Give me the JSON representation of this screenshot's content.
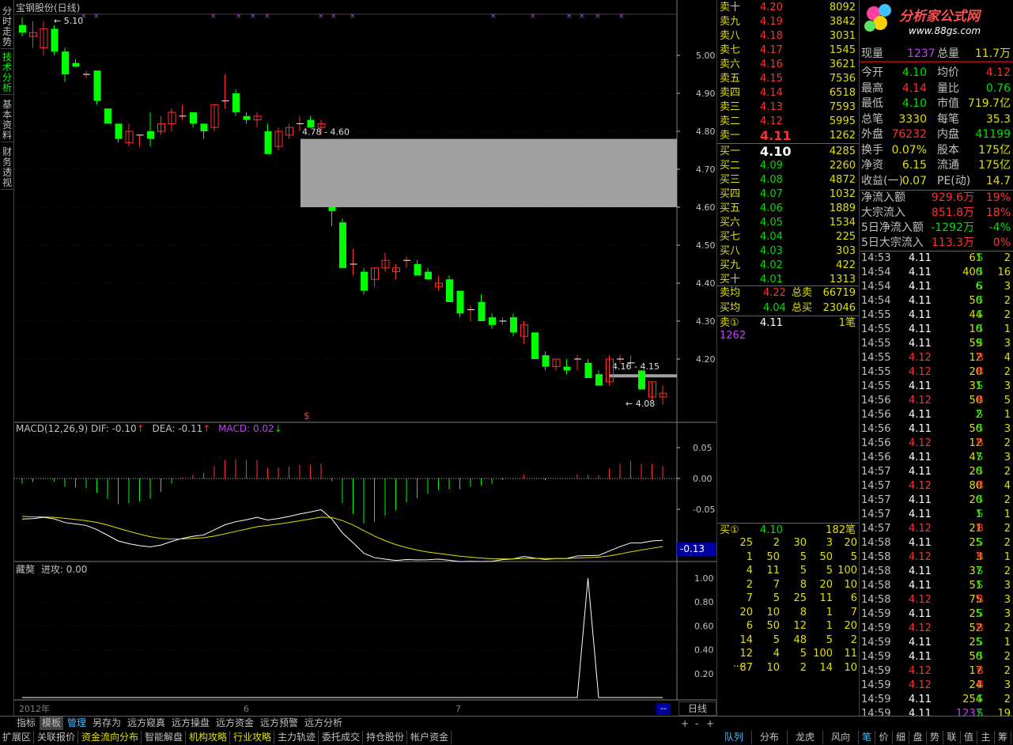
{
  "vertical_tabs": [
    {
      "label": "分时走势",
      "active": false
    },
    {
      "label": "技术分析",
      "active": true
    },
    {
      "label": "基本资料",
      "active": false
    },
    {
      "label": "财务透视",
      "active": false
    }
  ],
  "chart": {
    "title": "宝钢股份(日线)",
    "high_marker": "5.10",
    "low_marker": "4.08",
    "gap1_label": "4.78 - 4.60",
    "gap2_label": "4.16 - 4.15",
    "special_marker": "$",
    "price_axis": [
      "5.00",
      "4.90",
      "4.80",
      "4.70",
      "4.60",
      "4.50",
      "4.40",
      "4.30",
      "4.20"
    ],
    "candles": [
      [
        5.08,
        5.1,
        5.05,
        5.06
      ],
      [
        5.05,
        5.09,
        5.02,
        5.06
      ],
      [
        5.02,
        5.09,
        5.0,
        5.07
      ],
      [
        5.07,
        5.08,
        5.0,
        5.01
      ],
      [
        5.01,
        5.02,
        4.93,
        4.95
      ],
      [
        4.98,
        4.99,
        4.97,
        4.97
      ],
      [
        4.95,
        4.96,
        4.94,
        4.95
      ],
      [
        4.96,
        4.96,
        4.87,
        4.88
      ],
      [
        4.86,
        4.86,
        4.82,
        4.82
      ],
      [
        4.82,
        4.82,
        4.77,
        4.78
      ],
      [
        4.77,
        4.82,
        4.76,
        4.8
      ],
      [
        4.79,
        4.79,
        4.76,
        4.79
      ],
      [
        4.8,
        4.85,
        4.76,
        4.78
      ],
      [
        4.8,
        4.84,
        4.79,
        4.82
      ],
      [
        4.82,
        4.86,
        4.8,
        4.85
      ],
      [
        4.84,
        4.87,
        4.83,
        4.84
      ],
      [
        4.85,
        4.85,
        4.81,
        4.82
      ],
      [
        4.82,
        4.82,
        4.78,
        4.8
      ],
      [
        4.81,
        4.87,
        4.8,
        4.87
      ],
      [
        4.88,
        4.95,
        4.86,
        4.88
      ],
      [
        4.9,
        4.91,
        4.84,
        4.85
      ],
      [
        4.84,
        4.85,
        4.82,
        4.83
      ],
      [
        4.83,
        4.85,
        4.81,
        4.84
      ],
      [
        4.8,
        4.82,
        4.74,
        4.74
      ],
      [
        4.76,
        4.81,
        4.75,
        4.8
      ],
      [
        4.79,
        4.82,
        4.78,
        4.81
      ],
      [
        4.82,
        4.84,
        4.8,
        4.82
      ],
      [
        4.83,
        4.84,
        4.81,
        4.81
      ],
      [
        4.81,
        4.83,
        4.79,
        4.82
      ],
      [
        4.6,
        4.6,
        4.55,
        4.59
      ],
      [
        4.56,
        4.57,
        4.44,
        4.44
      ],
      [
        4.45,
        4.49,
        4.42,
        4.45
      ],
      [
        4.43,
        4.44,
        4.37,
        4.38
      ],
      [
        4.41,
        4.44,
        4.39,
        4.44
      ],
      [
        4.44,
        4.48,
        4.43,
        4.46
      ],
      [
        4.43,
        4.45,
        4.41,
        4.44
      ],
      [
        4.46,
        4.47,
        4.44,
        4.46
      ],
      [
        4.45,
        4.46,
        4.42,
        4.42
      ],
      [
        4.43,
        4.44,
        4.41,
        4.41
      ],
      [
        4.39,
        4.42,
        4.38,
        4.4
      ],
      [
        4.41,
        4.42,
        4.35,
        4.35
      ],
      [
        4.38,
        4.38,
        4.31,
        4.32
      ],
      [
        4.33,
        4.34,
        4.3,
        4.33
      ],
      [
        4.35,
        4.37,
        4.3,
        4.3
      ],
      [
        4.31,
        4.32,
        4.28,
        4.29
      ],
      [
        4.3,
        4.31,
        4.29,
        4.3
      ],
      [
        4.31,
        4.32,
        4.26,
        4.27
      ],
      [
        4.26,
        4.3,
        4.24,
        4.29
      ],
      [
        4.27,
        4.27,
        4.2,
        4.2
      ],
      [
        4.21,
        4.22,
        4.17,
        4.18
      ],
      [
        4.18,
        4.2,
        4.17,
        4.2
      ],
      [
        4.18,
        4.2,
        4.16,
        4.17
      ],
      [
        4.2,
        4.21,
        4.17,
        4.2
      ],
      [
        4.19,
        4.2,
        4.15,
        4.15
      ],
      [
        4.16,
        4.17,
        4.13,
        4.13
      ],
      [
        4.14,
        4.21,
        4.13,
        4.2
      ],
      [
        4.2,
        4.21,
        4.19,
        4.2
      ],
      [
        4.19,
        4.21,
        4.18,
        4.19
      ],
      [
        4.17,
        4.17,
        4.12,
        4.12
      ],
      [
        4.1,
        4.14,
        4.09,
        4.14
      ],
      [
        4.1,
        4.13,
        4.08,
        4.11
      ]
    ]
  },
  "macd": {
    "title": "MACD(12,26,9)",
    "dif_label": "DIF: -0.10",
    "dea_label": "DEA: -0.11",
    "macd_label": "MACD: 0.02",
    "axis": [
      "0.05",
      "0.00",
      "-0.05"
    ],
    "current_badge": "-0.13"
  },
  "sub": {
    "title": "藏獒",
    "value_label": "进攻: 0.00",
    "axis": [
      "1.00",
      "0.80",
      "0.60",
      "0.40",
      "0.20"
    ]
  },
  "time_axis": [
    "2012年",
    "6",
    "7"
  ],
  "period_label": "日线",
  "period_buttons": [
    "+",
    "-",
    "+"
  ],
  "toolbar1": [
    "指标",
    "模板",
    "管理",
    "另存为",
    "远方窥真",
    "远方操盘",
    "远方资金",
    "远方预警",
    "远方分析"
  ],
  "toolbar2": [
    "扩展区",
    "关联报价",
    "资金流向分布",
    "智能解盘",
    "机构攻略",
    "行业攻略",
    "主力轨迹",
    "委托成交",
    "持仓股份",
    "帐户资金"
  ],
  "order_book": {
    "asks": [
      [
        "卖十",
        "4.20",
        "8092"
      ],
      [
        "卖九",
        "4.19",
        "3842"
      ],
      [
        "卖八",
        "4.18",
        "3031"
      ],
      [
        "卖七",
        "4.17",
        "1545"
      ],
      [
        "卖六",
        "4.16",
        "3621"
      ],
      [
        "卖五",
        "4.15",
        "7536"
      ],
      [
        "卖四",
        "4.14",
        "6518"
      ],
      [
        "卖三",
        "4.13",
        "7593"
      ],
      [
        "卖二",
        "4.12",
        "5995"
      ],
      [
        "卖一",
        "4.11",
        "1262"
      ]
    ],
    "bids": [
      [
        "买一",
        "4.10",
        "4285"
      ],
      [
        "买二",
        "4.09",
        "2260"
      ],
      [
        "买三",
        "4.08",
        "4872"
      ],
      [
        "买四",
        "4.07",
        "1032"
      ],
      [
        "买五",
        "4.06",
        "1889"
      ],
      [
        "买六",
        "4.05",
        "1534"
      ],
      [
        "买七",
        "4.04",
        "225"
      ],
      [
        "买八",
        "4.03",
        "303"
      ],
      [
        "买九",
        "4.02",
        "422"
      ],
      [
        "买十",
        "4.01",
        "1313"
      ]
    ],
    "ask_avg_label": "卖均",
    "ask_avg": "4.22",
    "ask_total_label": "总卖",
    "ask_total": "66719",
    "bid_avg_label": "买均",
    "bid_avg": "4.04",
    "bid_total_label": "总买",
    "bid_total": "23046",
    "sell1_label": "卖①",
    "sell1_price": "4.11",
    "sell1_count": "1笔",
    "sell1_vol": "1262",
    "buy1_label": "买①",
    "buy1_price": "4.10",
    "buy1_count": "182笔",
    "buy1_queue": [
      [
        "25",
        "2",
        "30",
        "3",
        "20"
      ],
      [
        "1",
        "50",
        "5",
        "50",
        "5"
      ],
      [
        "4",
        "11",
        "5",
        "5",
        "100"
      ],
      [
        "2",
        "7",
        "8",
        "20",
        "10"
      ],
      [
        "7",
        "5",
        "25",
        "11",
        "6"
      ],
      [
        "20",
        "10",
        "8",
        "1",
        "7"
      ],
      [
        "6",
        "50",
        "12",
        "1",
        "20"
      ],
      [
        "14",
        "5",
        "48",
        "5",
        "2"
      ],
      [
        "12",
        "4",
        "5",
        "100",
        "11"
      ],
      [
        "87",
        "10",
        "2",
        "14",
        "10"
      ]
    ],
    "buy1_more": "...."
  },
  "quote": {
    "logo_text": "分析家公式网",
    "logo_url": "www.88gs.com",
    "now_label": "现量",
    "now": "1237",
    "total_label": "总量",
    "total": "11.7万",
    "rows": [
      [
        "今开",
        "4.10",
        "均价",
        "4.12"
      ],
      [
        "最高",
        "4.14",
        "量比",
        "0.76"
      ],
      [
        "最低",
        "4.10",
        "市值",
        "719.7亿"
      ],
      [
        "总笔",
        "3330",
        "每笔",
        "35.3"
      ],
      [
        "外盘",
        "76232",
        "内盘",
        "41199"
      ],
      [
        "换手",
        "0.07%",
        "股本",
        "175亿"
      ],
      [
        "净资",
        "6.15",
        "流通",
        "175亿"
      ],
      [
        "收益(一)",
        "0.07",
        "PE(动)",
        "14.7"
      ]
    ],
    "flow": [
      [
        "净流入额",
        "929.6万",
        "19%"
      ],
      [
        "大宗流入",
        "851.8万",
        "18%"
      ],
      [
        "5日净流入额",
        "-1292万",
        "-4%"
      ],
      [
        "5日大宗流入",
        "113.3万",
        "0%"
      ]
    ]
  },
  "ticks": [
    [
      "14:53",
      "4.11",
      "61",
      "S",
      "2"
    ],
    [
      "14:54",
      "4.11",
      "400",
      "S",
      "16"
    ],
    [
      "14:54",
      "4.11",
      "6",
      "S",
      "3"
    ],
    [
      "14:54",
      "4.11",
      "50",
      "S",
      "2"
    ],
    [
      "14:55",
      "4.11",
      "44",
      "S",
      "2"
    ],
    [
      "14:55",
      "4.11",
      "10",
      "S",
      "1"
    ],
    [
      "14:55",
      "4.11",
      "59",
      "S",
      "3"
    ],
    [
      "14:55",
      "4.12",
      "12",
      "B",
      "4"
    ],
    [
      "14:55",
      "4.12",
      "20",
      "B",
      "2"
    ],
    [
      "14:55",
      "4.11",
      "31",
      "S",
      "3"
    ],
    [
      "14:56",
      "4.12",
      "50",
      "B",
      "5"
    ],
    [
      "14:56",
      "4.11",
      "2",
      "S",
      "1"
    ],
    [
      "14:56",
      "4.11",
      "50",
      "S",
      "3"
    ],
    [
      "14:56",
      "4.12",
      "12",
      "B",
      "2"
    ],
    [
      "14:56",
      "4.11",
      "47",
      "S",
      "3"
    ],
    [
      "14:57",
      "4.11",
      "20",
      "S",
      "2"
    ],
    [
      "14:57",
      "4.12",
      "80",
      "B",
      "4"
    ],
    [
      "14:57",
      "4.11",
      "20",
      "S",
      "2"
    ],
    [
      "14:57",
      "4.11",
      "1",
      "S",
      "1"
    ],
    [
      "14:57",
      "4.12",
      "21",
      "B",
      "2"
    ],
    [
      "14:58",
      "4.11",
      "25",
      "S",
      "2"
    ],
    [
      "14:58",
      "4.12",
      "3",
      "B",
      "1"
    ],
    [
      "14:58",
      "4.11",
      "37",
      "S",
      "2"
    ],
    [
      "14:58",
      "4.11",
      "51",
      "S",
      "3"
    ],
    [
      "14:58",
      "4.12",
      "75",
      "B",
      "3"
    ],
    [
      "14:59",
      "4.11",
      "25",
      "S",
      "3"
    ],
    [
      "14:59",
      "4.12",
      "52",
      "B",
      "2"
    ],
    [
      "14:59",
      "4.11",
      "25",
      "S",
      "1"
    ],
    [
      "14:59",
      "4.11",
      "50",
      "S",
      "2"
    ],
    [
      "14:59",
      "4.12",
      "17",
      "B",
      "2"
    ],
    [
      "14:59",
      "4.12",
      "24",
      "B",
      "3"
    ],
    [
      "14:59",
      "4.11",
      "254",
      "S",
      "2"
    ],
    [
      "14:59",
      "4.11",
      "1237",
      "S",
      "19"
    ]
  ],
  "ticks_note": "",
  "right_tabs": [
    "队列",
    "分布",
    "龙虎",
    "风向"
  ],
  "right_tabs2": [
    "笔",
    "价",
    "细",
    "盘",
    "势",
    "联",
    "值",
    "主",
    "筹"
  ],
  "colors": {
    "up": "#ff3030",
    "down": "#00ff00",
    "axis": "#c0c0c0",
    "gap": "#a0a0a0",
    "dif": "#ffffff",
    "dea": "#e0e000"
  }
}
